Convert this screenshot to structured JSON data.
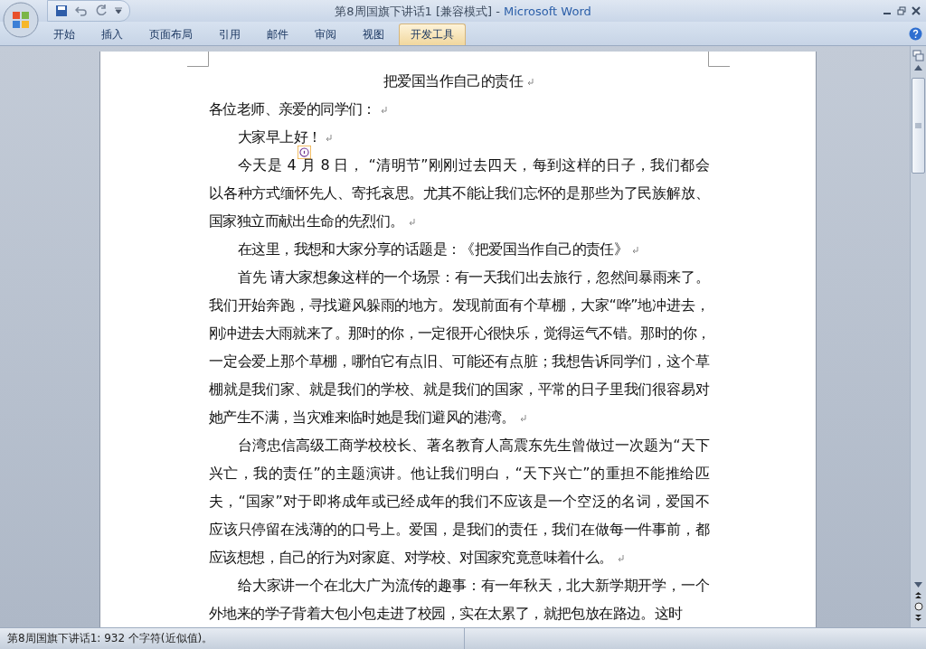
{
  "window": {
    "document_title": "第8周国旗下讲话1 [兼容模式]",
    "separator": " - ",
    "app_name": "Microsoft Word"
  },
  "ribbon_tabs": [
    {
      "label": "开始",
      "selected": false
    },
    {
      "label": "插入",
      "selected": false
    },
    {
      "label": "页面布局",
      "selected": false
    },
    {
      "label": "引用",
      "selected": false
    },
    {
      "label": "邮件",
      "selected": false
    },
    {
      "label": "审阅",
      "selected": false
    },
    {
      "label": "视图",
      "selected": false
    },
    {
      "label": "开发工具",
      "selected": true
    }
  ],
  "document": {
    "paragraphs": [
      {
        "kind": "title",
        "mark": true,
        "smart_tag": false,
        "lines": [
          "把爱国当作自己的责任"
        ]
      },
      {
        "kind": "plain",
        "mark": true,
        "smart_tag": false,
        "lines": [
          "各位老师、亲爱的同学们："
        ]
      },
      {
        "kind": "body",
        "mark": true,
        "smart_tag": true,
        "lines": [
          "大家早上好！"
        ]
      },
      {
        "kind": "body",
        "mark": true,
        "smart_tag": false,
        "lines": [
          "今天是 4 月 8 日， “清明节”刚刚过去四天，每到这样的日子，我们都会",
          "以各种方式缅怀先人、寄托哀思。尤其不能让我们忘怀的是那些为了民族解放、",
          "国家独立而献出生命的先烈们。"
        ]
      },
      {
        "kind": "body",
        "mark": true,
        "smart_tag": false,
        "lines": [
          "在这里，我想和大家分享的话题是：《把爱国当作自己的责任》"
        ]
      },
      {
        "kind": "body",
        "mark": true,
        "smart_tag": false,
        "lines": [
          "首先 请大家想象这样的一个场景：有一天我们出去旅行，忽然间暴雨来了。",
          "我们开始奔跑，寻找避风躲雨的地方。发现前面有个草棚，大家“哗”地冲进去，",
          "刚冲进去大雨就来了。那时的你，一定很开心很快乐，觉得运气不错。那时的你，",
          "一定会爱上那个草棚，哪怕它有点旧、可能还有点脏；我想告诉同学们，这个草",
          "棚就是我们家、就是我们的学校、就是我们的国家，平常的日子里我们很容易对",
          "她产生不满，当灾难来临时她是我们避风的港湾。"
        ]
      },
      {
        "kind": "body",
        "mark": true,
        "smart_tag": false,
        "lines": [
          "台湾忠信高级工商学校校长、著名教育人高震东先生曾做过一次题为“天下",
          "兴亡，我的责任”的主题演讲。他让我们明白，“天下兴亡”的重担不能推给匹",
          "夫，“国家”对于即将成年或已经成年的我们不应该是一个空泛的名词，爱国不",
          "应该只停留在浅薄的的口号上。爱国，是我们的责任，我们在做每一件事前，都",
          "应该想想，自己的行为对家庭、对学校、对国家究竟意味着什么。"
        ]
      },
      {
        "kind": "body",
        "mark": false,
        "smart_tag": false,
        "lines": [
          "给大家讲一个在北大广为流传的趣事：有一年秋天，北大新学期开学，一个",
          "外地来的学子背着大包小包走进了校园，实在太累了，就把包放在路边。这时"
        ]
      }
    ]
  },
  "status_bar": {
    "text": "第8周国旗下讲话1: 932 个字符(近似值)。"
  }
}
